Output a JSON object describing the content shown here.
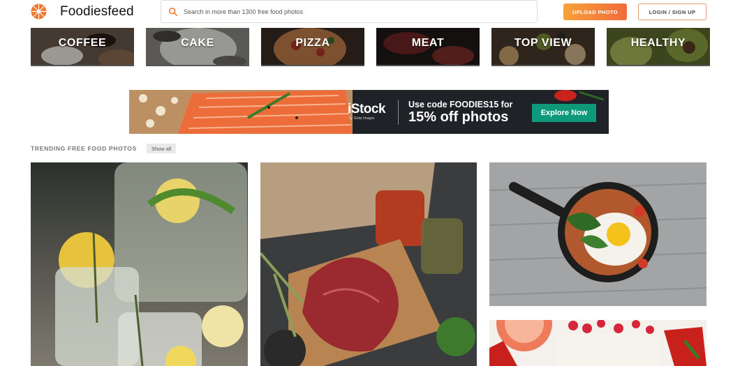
{
  "header": {
    "site_name": "Foodiesfeed",
    "search_placeholder": "Search in more than 1300 free food photos",
    "upload_label": "UPLOAD PHOTO",
    "login_label": "LOGIN / SIGN UP"
  },
  "categories": [
    {
      "label": "COFFEE"
    },
    {
      "label": "CAKE"
    },
    {
      "label": "PIZZA"
    },
    {
      "label": "MEAT"
    },
    {
      "label": "TOP VIEW"
    },
    {
      "label": "HEALTHY"
    }
  ],
  "ad": {
    "brand": "iStock",
    "brand_sub": "by Getty Images",
    "code_line": "Use code FOODIES15 for",
    "offer_line": "15% off photos",
    "cta_label": "Explore Now"
  },
  "trending": {
    "title": "TRENDING FREE FOOD PHOTOS",
    "show_all_label": "Show all"
  },
  "colors": {
    "accent_orange": "#f26a3b",
    "ad_green": "#0e9a7a"
  }
}
